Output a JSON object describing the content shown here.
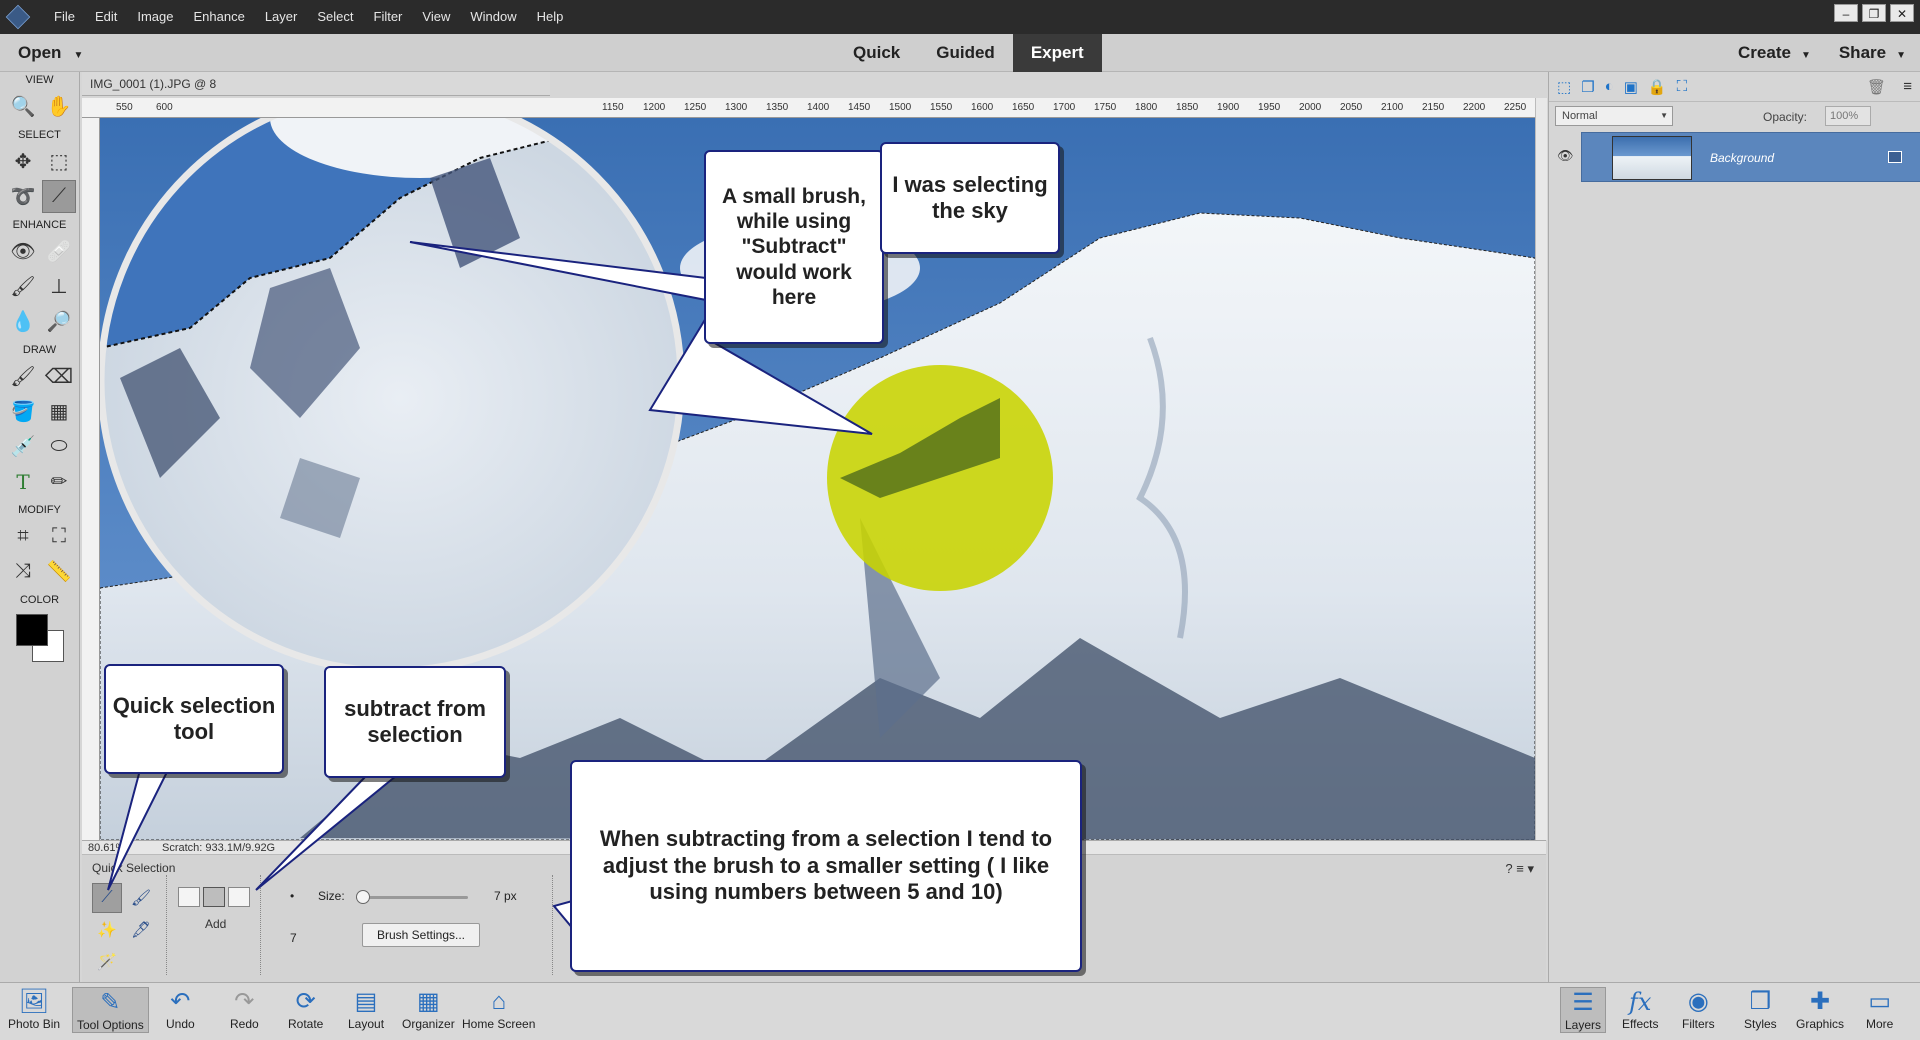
{
  "menu": [
    "File",
    "Edit",
    "Image",
    "Enhance",
    "Layer",
    "Select",
    "Filter",
    "View",
    "Window",
    "Help"
  ],
  "modebar": {
    "open": "Open",
    "modes": [
      "Quick",
      "Guided",
      "Expert"
    ],
    "active_mode": "Expert",
    "create": "Create",
    "share": "Share"
  },
  "toolbox": {
    "sections": [
      "VIEW",
      "SELECT",
      "ENHANCE",
      "DRAW",
      "MODIFY",
      "COLOR"
    ]
  },
  "document": {
    "tab": "IMG_0001 (1).JPG @ 8",
    "ruler_ticks": [
      "550",
      "600",
      "1150",
      "1200",
      "1250",
      "1300",
      "1350",
      "1400",
      "1450",
      "1500",
      "1550",
      "1600",
      "1650",
      "1700",
      "1750",
      "1800",
      "1850",
      "1900",
      "1950",
      "2000",
      "2050",
      "2100",
      "2150",
      "2200",
      "2250"
    ],
    "zoom": "80.61%",
    "scratch": "Scratch: 933.1M/9.92G"
  },
  "tool_options": {
    "title": "Quick Selection",
    "mode_label": "Add",
    "size_label": "Size:",
    "size_value": "7 px",
    "size_fraction": 0.0,
    "hardness": "7",
    "brush_settings": "Brush Settings..."
  },
  "layers": {
    "blend": "Normal",
    "opacity_label": "Opacity:",
    "opacity": "100%",
    "layer_name": "Background"
  },
  "bottom_left": [
    "Photo Bin",
    "Tool Options",
    "Undo",
    "Redo",
    "Rotate",
    "Layout",
    "Organizer",
    "Home Screen"
  ],
  "bottom_right": [
    "Layers",
    "Effects",
    "Filters",
    "Styles",
    "Graphics",
    "More"
  ],
  "callouts": {
    "brush": "A small brush, while using \"Subtract\" would work here",
    "sky": "I was selecting the sky",
    "quick": "Quick selection tool",
    "subtract": "subtract from selection",
    "note": "When subtracting from a selection I tend to adjust the brush to a smaller setting ( I like using numbers between 5 and 10)"
  },
  "colors": {
    "accent": "#1a237e",
    "highlight": "#c8d400",
    "panel_blue": "#5b86bd"
  }
}
